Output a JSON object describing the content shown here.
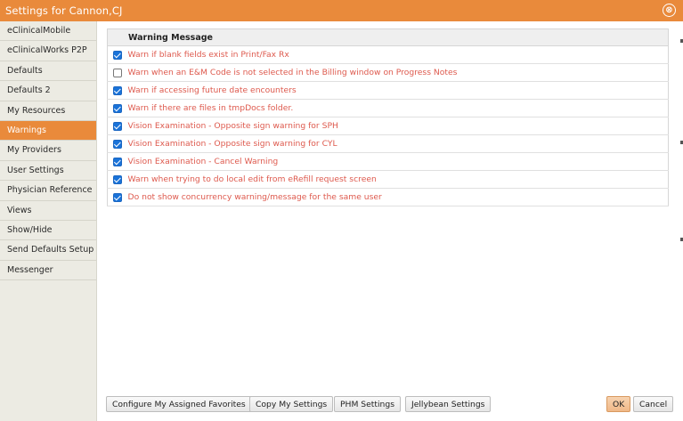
{
  "window": {
    "title": "Settings for Cannon,CJ",
    "close_symbol": "⊗"
  },
  "sidebar": {
    "items": [
      {
        "label": "eClinicalMobile",
        "active": false
      },
      {
        "label": "eClinicalWorks P2P",
        "active": false
      },
      {
        "label": "Defaults",
        "active": false
      },
      {
        "label": "Defaults 2",
        "active": false
      },
      {
        "label": "My Resources",
        "active": false
      },
      {
        "label": "Warnings",
        "active": true
      },
      {
        "label": "My Providers",
        "active": false
      },
      {
        "label": "User Settings",
        "active": false
      },
      {
        "label": "Physician Reference",
        "active": false
      },
      {
        "label": "Views",
        "active": false
      },
      {
        "label": "Show/Hide",
        "active": false
      },
      {
        "label": "Send Defaults Setup",
        "active": false
      },
      {
        "label": "Messenger",
        "active": false
      }
    ]
  },
  "warnings": {
    "header": "Warning Message",
    "rows": [
      {
        "checked": true,
        "message": "Warn if blank fields exist in Print/Fax Rx"
      },
      {
        "checked": false,
        "message": "Warn when an E&M Code is not selected in the Billing window on Progress Notes"
      },
      {
        "checked": true,
        "message": "Warn if accessing future date encounters"
      },
      {
        "checked": true,
        "message": "Warn if there are files in tmpDocs folder."
      },
      {
        "checked": true,
        "message": "Vision Examination - Opposite sign warning for SPH"
      },
      {
        "checked": true,
        "message": "Vision Examination - Opposite sign warning for CYL"
      },
      {
        "checked": true,
        "message": "Vision Examination - Cancel Warning"
      },
      {
        "checked": true,
        "message": "Warn when trying to do local edit from eRefill request screen"
      },
      {
        "checked": true,
        "message": "Do not show concurrency warning/message for the same user"
      }
    ]
  },
  "footer": {
    "configure_favorites": "Configure My Assigned Favorites",
    "copy_settings": "Copy My Settings",
    "phm_settings": "PHM Settings",
    "jellybean_settings": "Jellybean Settings",
    "ok": "OK",
    "cancel": "Cancel"
  },
  "colors": {
    "accent": "#e98a3b",
    "warning_text": "#de5a4e",
    "checkbox": "#1a73d9"
  }
}
